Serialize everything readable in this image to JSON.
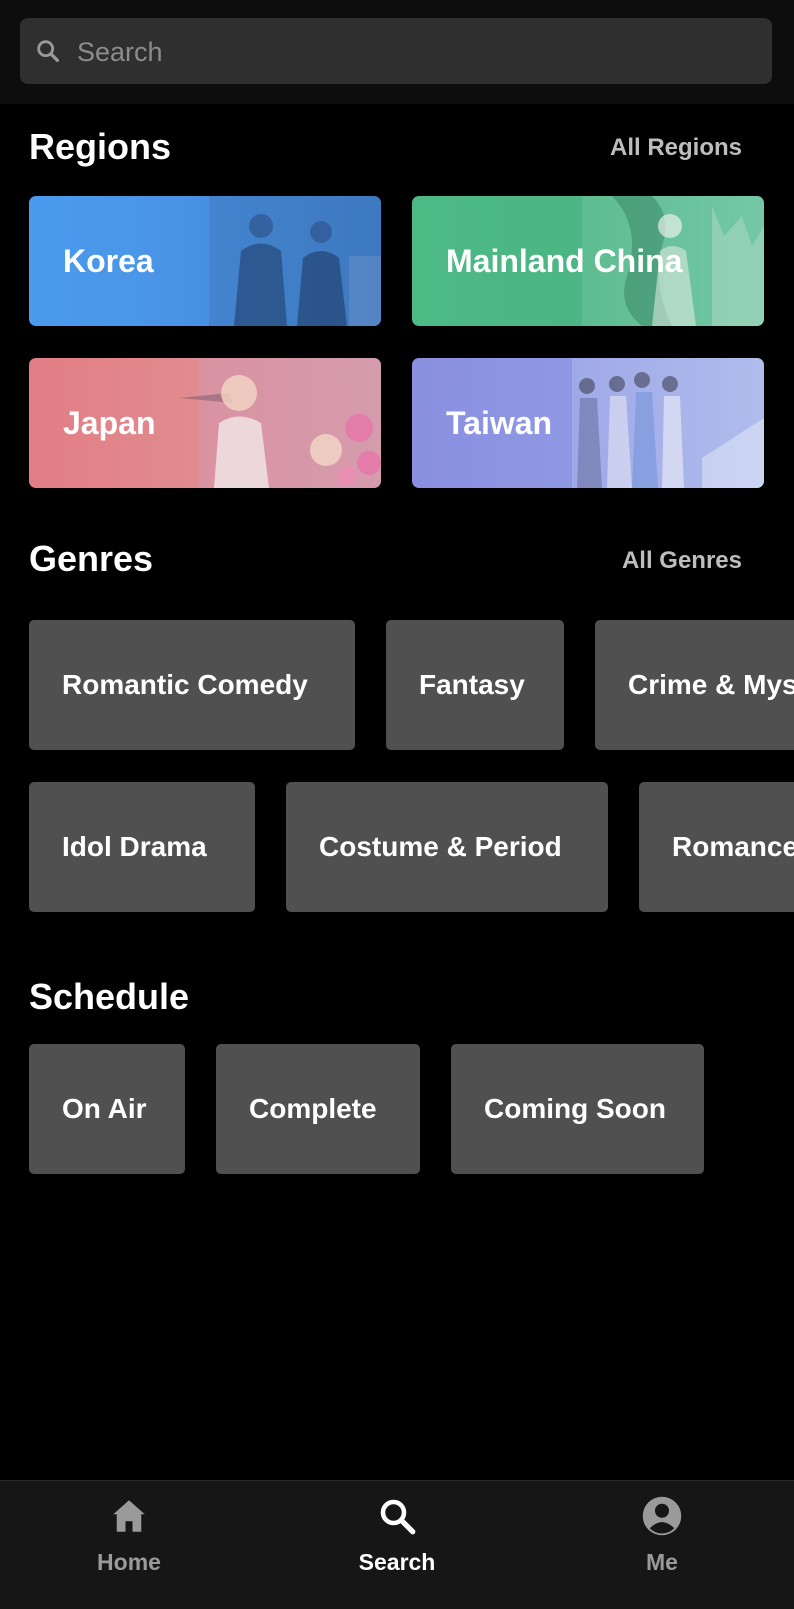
{
  "search": {
    "placeholder": "Search",
    "icon": "search-icon"
  },
  "regions": {
    "title": "Regions",
    "all_label": "All Regions",
    "items": [
      {
        "label": "Korea",
        "color": "#4a94e6"
      },
      {
        "label": "Mainland China",
        "color": "#4cb584"
      },
      {
        "label": "Japan",
        "color": "#e18b8f"
      },
      {
        "label": "Taiwan",
        "color": "#8f98e4"
      }
    ]
  },
  "genres": {
    "title": "Genres",
    "all_label": "All Genres",
    "items": [
      {
        "label": "Romantic Comedy"
      },
      {
        "label": "Fantasy"
      },
      {
        "label": "Crime & Mystery"
      },
      {
        "label": "Idol Drama"
      },
      {
        "label": "Costume & Period"
      },
      {
        "label": "Romance"
      }
    ]
  },
  "schedule": {
    "title": "Schedule",
    "items": [
      {
        "label": "On Air"
      },
      {
        "label": "Complete"
      },
      {
        "label": "Coming Soon"
      }
    ]
  },
  "nav": {
    "items": [
      {
        "label": "Home",
        "icon": "home-icon",
        "active": false
      },
      {
        "label": "Search",
        "icon": "search-icon",
        "active": true
      },
      {
        "label": "Me",
        "icon": "user-icon",
        "active": false
      }
    ]
  },
  "colors": {
    "tag_bg": "#505050",
    "active_nav": "#ffffff",
    "inactive_nav": "#9a9a9a"
  }
}
